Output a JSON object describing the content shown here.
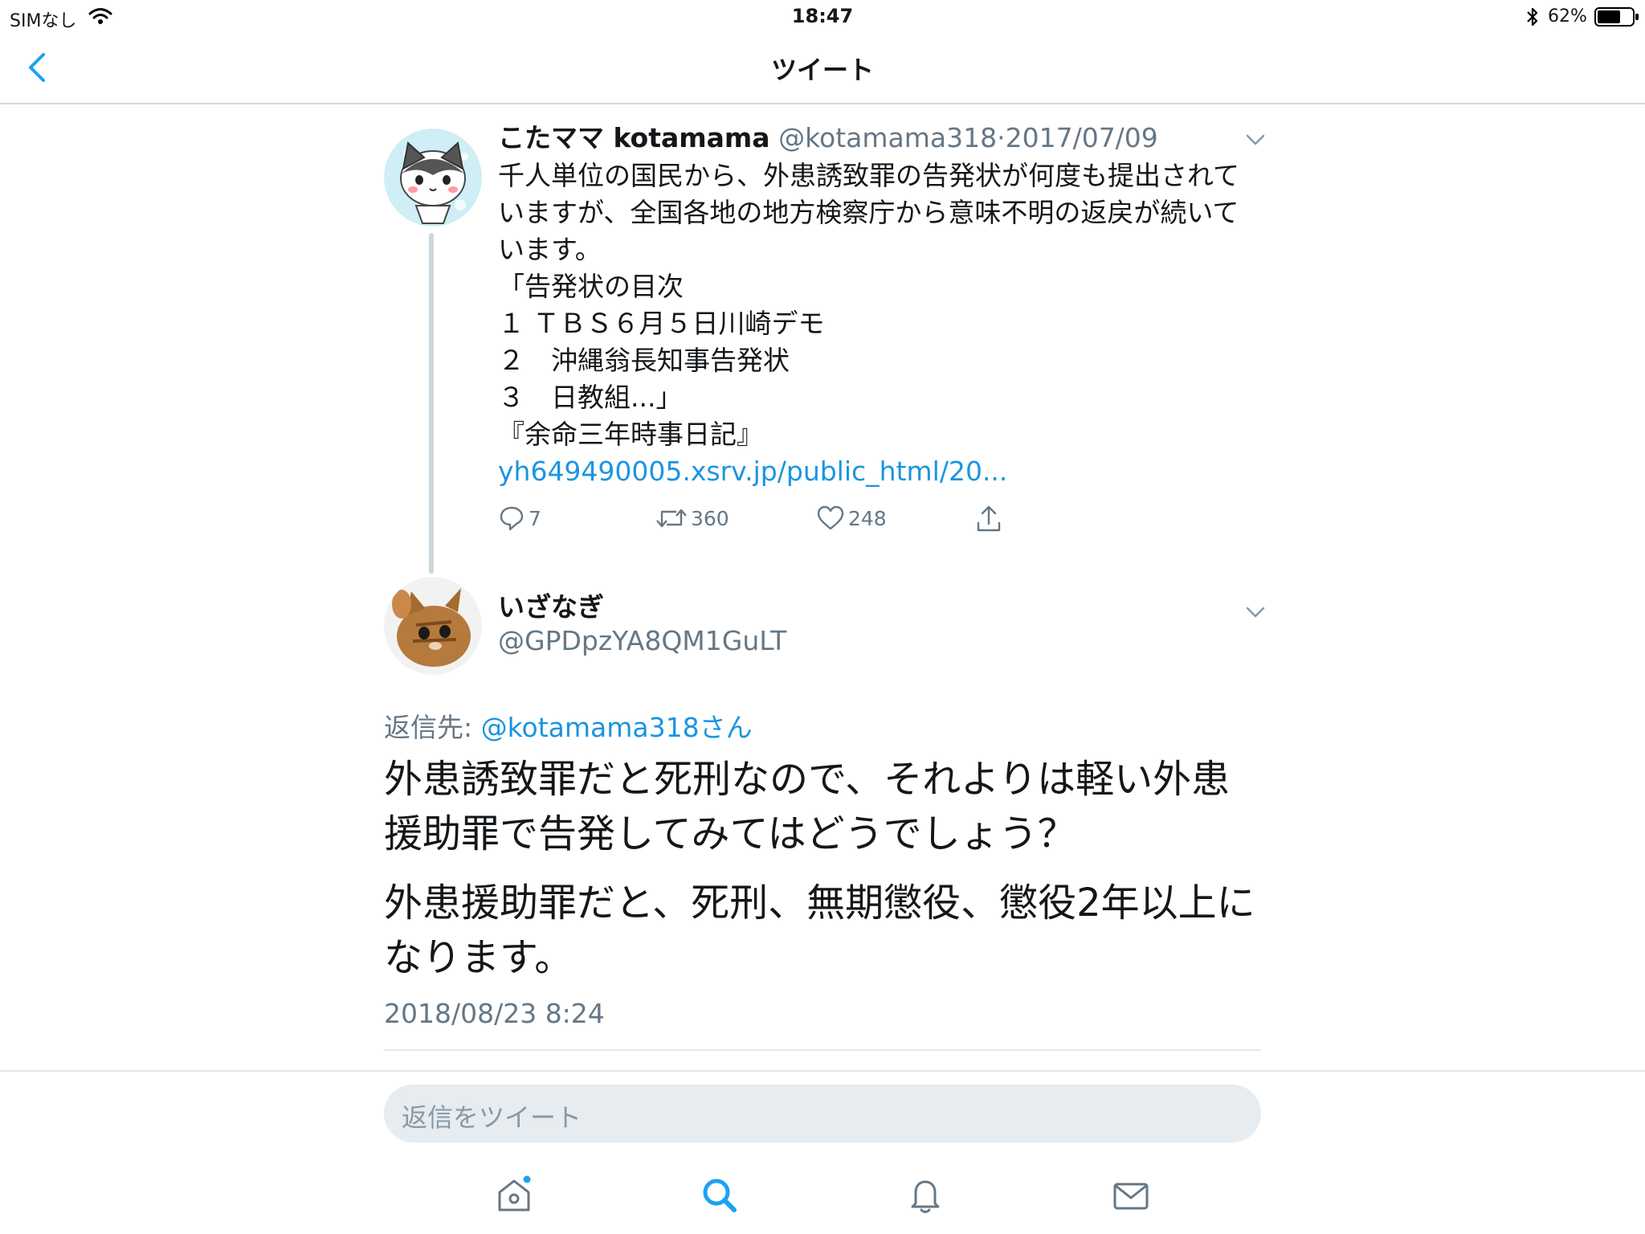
{
  "status_bar": {
    "carrier": "SIMなし",
    "time": "18:47",
    "battery": "62%"
  },
  "nav": {
    "title": "ツイート",
    "back_icon": "chevron-left-icon"
  },
  "tweet1": {
    "name": "こたママ kotamama",
    "handle": "@kotamama318",
    "separator": "·",
    "date": "2017/07/09",
    "lines": [
      "千人単位の国民から、外患誘致罪の告発状が何度も提出されて",
      "いますが、全国各地の地方検察庁から意味不明の返戻が続いて",
      "います。",
      "「告発状の目次",
      "１ ＴＢＳ６月５日川崎デモ",
      "２　沖縄翁長知事告発状",
      "３　日教組...」",
      "『余命三年時事日記』"
    ],
    "link": "yh649490005.xsrv.jp/public_html/20...",
    "replies": "7",
    "retweets": "360",
    "likes": "248"
  },
  "tweet2": {
    "name": "いざなぎ",
    "handle": "@GPDpzYA8QM1GuLT",
    "reply_to_label": "返信先: ",
    "reply_to_handle": "@kotamama318さん",
    "paragraph1": [
      "外患誘致罪だと死刑なので、それよりは軽い外患",
      "援助罪で告発してみてはどうでしょう？"
    ],
    "paragraph2": [
      "外患援助罪だと、死刑、無期懲役、懲役2年以上に",
      "なります。"
    ],
    "timestamp": "2018/08/23 8:24"
  },
  "reply_box": {
    "placeholder": "返信をツイート"
  },
  "tab_bar": {
    "icons": [
      "home-icon",
      "search-icon",
      "bell-icon",
      "mail-icon"
    ],
    "active": "search-icon"
  },
  "colors": {
    "accent": "#1da1f2",
    "link": "#1b95e0",
    "secondary_text": "#657786",
    "thread_line": "#ccd6dd"
  }
}
